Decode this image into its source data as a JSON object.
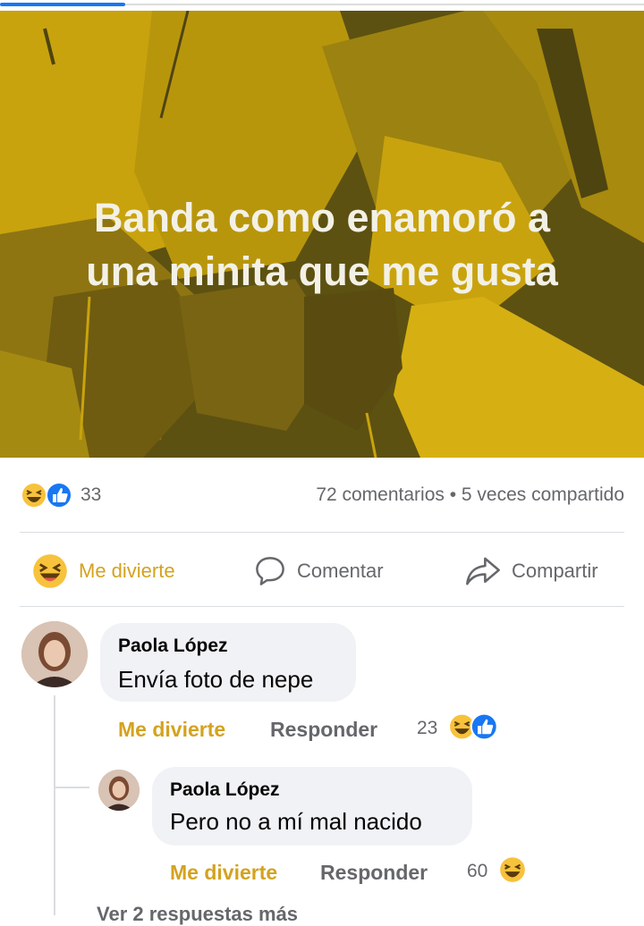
{
  "post": {
    "text_line1": "Banda como enamoró a",
    "text_line2": "una minita que me gusta",
    "background_color": "#c9a30e"
  },
  "stats": {
    "reaction_icons": [
      "laugh-icon",
      "like-icon"
    ],
    "reaction_count": "33",
    "comments_shares": "72 comentarios • 5 veces compartido"
  },
  "actions": {
    "like_label": "Me divierte",
    "comment_label": "Comentar",
    "share_label": "Compartir"
  },
  "comments": [
    {
      "author": "Paola López",
      "text": "Envía foto de nepe",
      "like_label": "Me divierte",
      "reply_label": "Responder",
      "reaction_count": "23",
      "reaction_icons": [
        "laugh-icon",
        "like-icon"
      ]
    },
    {
      "author": "Paola López",
      "text": "Pero no a mí mal nacido",
      "like_label": "Me divierte",
      "reply_label": "Responder",
      "reaction_count": "60",
      "reaction_icons": [
        "laugh-icon"
      ]
    }
  ],
  "more_replies": "Ver 2 respuestas más"
}
